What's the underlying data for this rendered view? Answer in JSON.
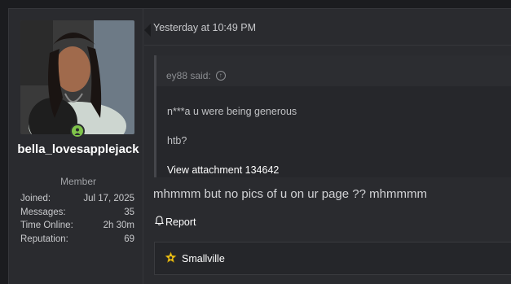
{
  "user": {
    "name": "bella_lovesapplejack",
    "title": "Member",
    "stats": [
      {
        "label": "Joined:",
        "value": "Jul 17, 2025"
      },
      {
        "label": "Messages:",
        "value": "35"
      },
      {
        "label": "Time Online:",
        "value": "2h 30m"
      },
      {
        "label": "Reputation:",
        "value": "69"
      }
    ],
    "online_color": "#7fc34a"
  },
  "post": {
    "date": "Yesterday at 10:49 PM",
    "quote": {
      "author_said": "ey88 said:",
      "line1": "n***a u were being generous",
      "line2": "htb?",
      "attachment": "View attachment 134642"
    },
    "body": "mhmmm but no pics of u on ur page ?? mhmmmm",
    "report_label": "Report",
    "signature": "Smallville"
  },
  "icons": {
    "online": "user-online-icon",
    "jump": "arrow-up-circle-icon",
    "report": "bell-icon",
    "signature": "badge-icon"
  }
}
